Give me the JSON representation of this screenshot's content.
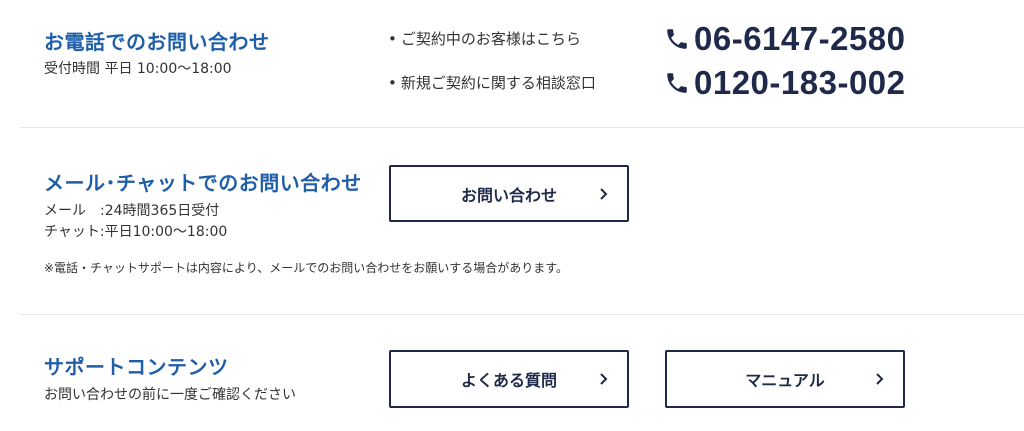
{
  "phone_section": {
    "title": "お電話でのお問い合わせ",
    "hours": "受付時間 平日 10:00〜18:00",
    "lines": [
      {
        "bullet": "•",
        "label": "ご契約中のお客様はこちら",
        "icon": "phone-icon",
        "number": "06-6147-2580"
      },
      {
        "bullet": "•",
        "label": "新規ご契約に関する相談窓口",
        "icon": "phone-icon",
        "number": "0120-183-002"
      }
    ]
  },
  "mail_section": {
    "title": "メール･チャットでのお問い合わせ",
    "mail_hours": "メール　:24時間365日受付",
    "chat_hours": "チャット:平日10:00〜18:00",
    "button_label": "お問い合わせ",
    "note": "※電話・チャットサポートは内容により、メールでのお問い合わせをお願いする場合があります。"
  },
  "support_section": {
    "title": "サポートコンテンツ",
    "subtitle": "お問い合わせの前に一度ご確認ください",
    "buttons": [
      {
        "label": "よくある質問",
        "icon": "chevron-right-icon"
      },
      {
        "label": "マニュアル",
        "icon": "chevron-right-icon"
      }
    ]
  },
  "colors": {
    "title_blue": "#1f5ea8",
    "navy": "#1f2a4a",
    "divider": "#e6e6e6"
  }
}
